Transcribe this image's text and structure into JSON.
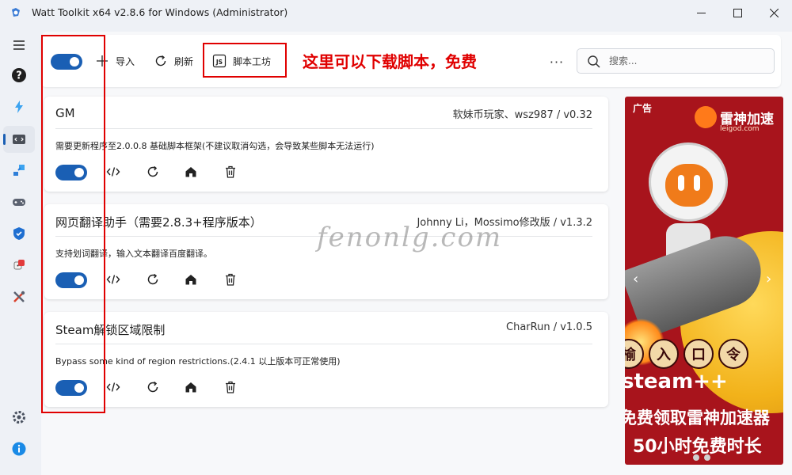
{
  "window": {
    "title": "Watt Toolkit x64 v2.8.6 for Windows (Administrator)",
    "controls": [
      "minimize",
      "maximize",
      "close"
    ]
  },
  "sidebar": {
    "items": [
      {
        "icon": "menu-icon",
        "active": false
      },
      {
        "icon": "help-icon",
        "active": false
      },
      {
        "icon": "lightning-icon",
        "active": false
      },
      {
        "icon": "script-icon",
        "active": true
      },
      {
        "icon": "puzzle-icon",
        "active": false
      },
      {
        "icon": "gamepad-icon",
        "active": false
      },
      {
        "icon": "shield-icon",
        "active": false
      },
      {
        "icon": "dice-icon",
        "active": false
      },
      {
        "icon": "tools-icon",
        "active": false
      },
      {
        "icon": "settings-icon",
        "active": false
      },
      {
        "icon": "info-icon",
        "active": false
      }
    ]
  },
  "toolbar": {
    "toggle_on": true,
    "import_label": "导入",
    "refresh_label": "刷新",
    "workshop_label": "脚本工坊",
    "annotation": "这里可以下载脚本，免费",
    "more": "···",
    "search_placeholder": "搜索..."
  },
  "scripts": [
    {
      "title": "GM",
      "author": "软妹币玩家、wsz987 / v0.32",
      "description": "需要更新程序至2.0.0.8 基础脚本框架(不建议取消勾选，会导致某些脚本无法运行)",
      "enabled": true
    },
    {
      "title": "网页翻译助手（需要2.8.3+程序版本）",
      "author": "Johnny Li，Mossimo修改版 / v1.3.2",
      "description": "支持划词翻译，输入文本翻译百度翻译。",
      "enabled": true
    },
    {
      "title": "Steam解锁区域限制",
      "author": "CharRun / v1.0.5",
      "description": "Bypass some kind of region restrictions.(2.4.1 以上版本可正常使用)",
      "enabled": true
    }
  ],
  "ad": {
    "label": "广告",
    "brand_name": "雷神加速",
    "brand_url": "leigod.com",
    "seals": [
      "榆",
      "入",
      "口",
      "令"
    ],
    "steam_text": "steam++",
    "line1": "免费领取雷神加速器",
    "line2": "50小时免费时长",
    "prev": "‹",
    "next": "›"
  },
  "watermark": "fenonlg.com",
  "colors": {
    "accent": "#1a5fb4",
    "highlight": "#e00000",
    "ad_bg": "#a8141c"
  }
}
